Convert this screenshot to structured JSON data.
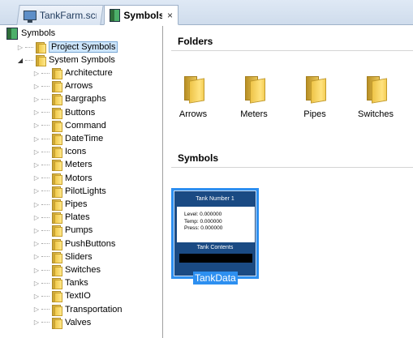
{
  "tabs": [
    {
      "label": "TankFarm.scr",
      "icon": "monitor-icon",
      "active": false
    },
    {
      "label": "Symbols",
      "icon": "symbol-book-icon",
      "active": true,
      "close": "×"
    }
  ],
  "tree": {
    "root": "Symbols",
    "project": "Project Symbols",
    "system": "System Symbols",
    "system_children": [
      "Architecture",
      "Arrows",
      "Bargraphs",
      "Buttons",
      "Command",
      "DateTime",
      "Icons",
      "Meters",
      "Motors",
      "PilotLights",
      "Pipes",
      "Plates",
      "Pumps",
      "PushButtons",
      "Sliders",
      "Switches",
      "Tanks",
      "TextIO",
      "Transportation",
      "Valves"
    ]
  },
  "content": {
    "folders_title": "Folders",
    "folders": [
      "Arrows",
      "Meters",
      "Pipes",
      "Switches"
    ],
    "symbols_title": "Symbols",
    "symbols": [
      {
        "caption": "TankData",
        "panel_title": "Tank Number 1",
        "lines": [
          "Level: 0.000000",
          "Temp: 0.000000",
          "Press: 0.000000"
        ],
        "footer": "Tank Contents"
      }
    ]
  },
  "colors": {
    "selection": "#2d8ff0",
    "panel": "#1a4a83",
    "tree_selected": "#cde5fb"
  }
}
